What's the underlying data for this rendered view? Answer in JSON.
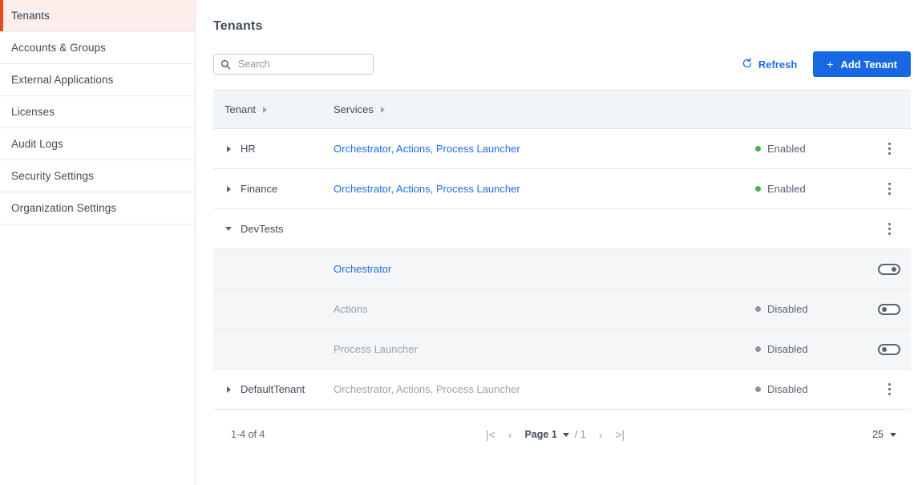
{
  "sidebar": {
    "items": [
      {
        "label": "Tenants",
        "active": true
      },
      {
        "label": "Accounts & Groups",
        "active": false
      },
      {
        "label": "External Applications",
        "active": false
      },
      {
        "label": "Licenses",
        "active": false
      },
      {
        "label": "Audit Logs",
        "active": false
      },
      {
        "label": "Security Settings",
        "active": false
      },
      {
        "label": "Organization Settings",
        "active": false
      }
    ]
  },
  "page": {
    "title": "Tenants"
  },
  "toolbar": {
    "search_placeholder": "Search",
    "search_value": "",
    "search_icon": "search-icon",
    "refresh_label": "Refresh",
    "refresh_icon": "refresh-icon",
    "add_tenant_label": "Add Tenant",
    "add_tenant_plus": "+"
  },
  "table": {
    "columns": [
      {
        "label": "Tenant",
        "sortable": true
      },
      {
        "label": "Services",
        "sortable": true
      }
    ],
    "rows": [
      {
        "tenant": "HR",
        "services": "Orchestrator, Actions, Process Launcher",
        "services_muted": false,
        "status": "Enabled",
        "status_state": "on",
        "expanded": false,
        "action": "kebab"
      },
      {
        "tenant": "Finance",
        "services": "Orchestrator, Actions, Process Launcher",
        "services_muted": false,
        "status": "Enabled",
        "status_state": "on",
        "expanded": false,
        "action": "kebab"
      },
      {
        "tenant": "DevTests",
        "services": "",
        "services_muted": false,
        "status": "",
        "status_state": "none",
        "expanded": true,
        "action": "kebab"
      },
      {
        "tenant": "",
        "services": "Orchestrator",
        "services_muted": false,
        "status": "",
        "status_state": "none",
        "sub": true,
        "action": "toggle",
        "toggle_state": "on"
      },
      {
        "tenant": "",
        "services": "Actions",
        "services_muted": true,
        "status": "Disabled",
        "status_state": "off",
        "sub": true,
        "action": "toggle",
        "toggle_state": "off"
      },
      {
        "tenant": "",
        "services": "Process Launcher",
        "services_muted": true,
        "status": "Disabled",
        "status_state": "off",
        "sub": true,
        "action": "toggle",
        "toggle_state": "off"
      },
      {
        "tenant": "DefaultTenant",
        "services": "Orchestrator, Actions, Process Launcher",
        "services_muted": true,
        "status": "Disabled",
        "status_state": "off",
        "expanded": false,
        "action": "kebab"
      }
    ]
  },
  "pagination": {
    "range_label": "1-4 of 4",
    "first_icon": "|<",
    "prev_icon": "‹",
    "page_label": "Page 1",
    "page_total": "/ 1",
    "next_icon": "›",
    "last_icon": ">|",
    "page_size": "25"
  },
  "colors": {
    "accent_blue": "#1668e3",
    "link_blue": "#1f6fe5",
    "active_orange": "#e8491f",
    "active_bg": "#fceeea",
    "enabled_green": "#4caf50",
    "disabled_gray": "#8c949e",
    "header_bg": "#f2f5f8",
    "subrow_bg": "#f5f6f7"
  }
}
